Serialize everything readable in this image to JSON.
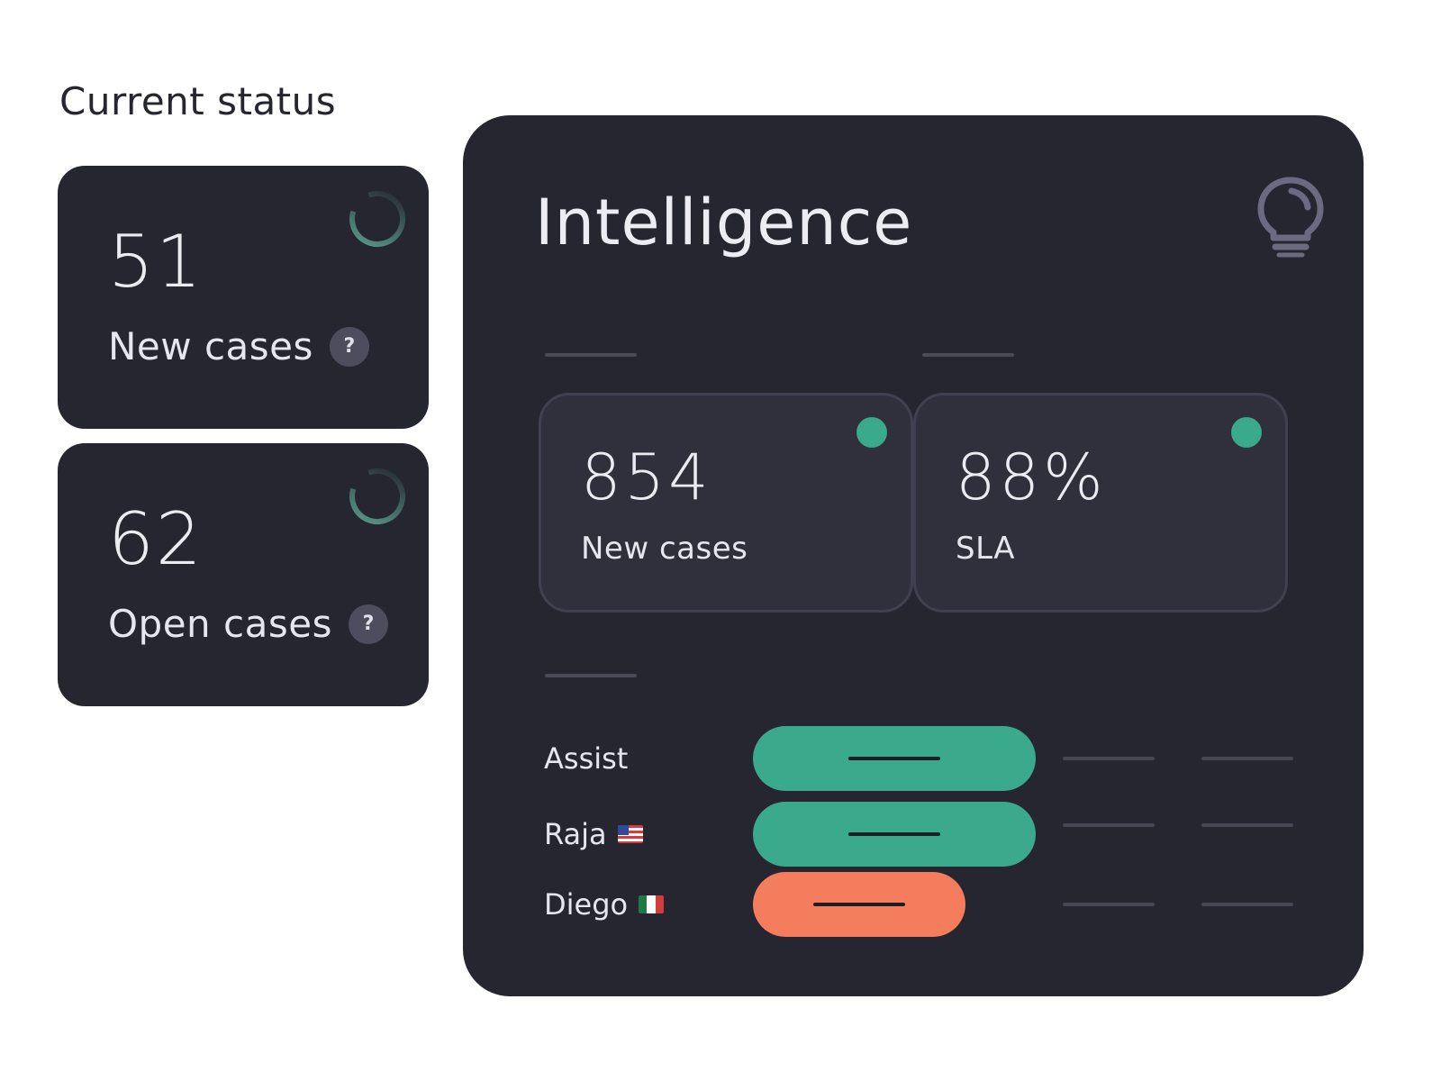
{
  "heading": "Current status",
  "status_cards": [
    {
      "value": "51",
      "label": "New cases",
      "help": "?"
    },
    {
      "value": "62",
      "label": "Open cases",
      "help": "?"
    }
  ],
  "intelligence": {
    "title": "Intelligence",
    "metrics": [
      {
        "value": "854",
        "label": "New cases"
      },
      {
        "value": "88%",
        "label": "SLA"
      }
    ],
    "agents": [
      {
        "name": "Assist",
        "flag": "",
        "status": "green"
      },
      {
        "name": "Raja",
        "flag": "us-flag",
        "status": "green"
      },
      {
        "name": "Diego",
        "flag": "mx-flag",
        "status": "orange"
      }
    ]
  },
  "colors": {
    "card_bg": "#262630",
    "accent_green": "#3aa98c",
    "accent_orange": "#f37d5c"
  }
}
